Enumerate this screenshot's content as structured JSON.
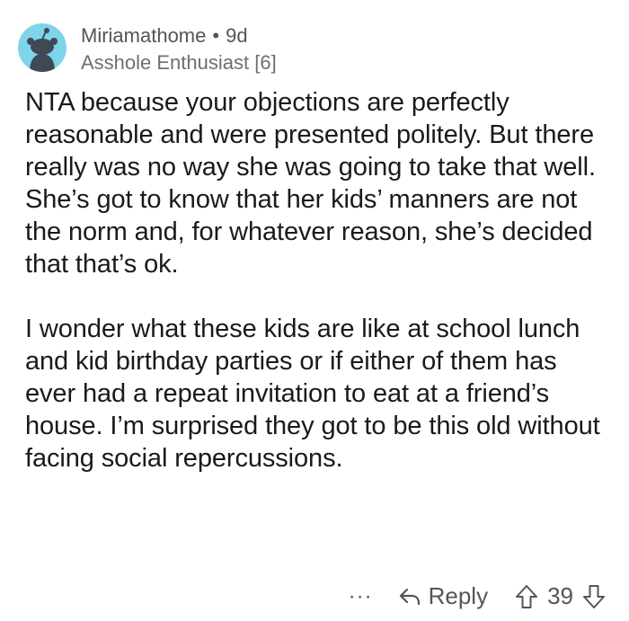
{
  "comment": {
    "username": "Miriamathome",
    "separator": "•",
    "age": "9d",
    "flair": "Asshole Enthusiast [6]",
    "paragraphs": [
      "NTA because your objections are perfectly reasonable and were presented politely. But there really was no way she was going to take that well. She’s got to know that her kids’ manners are not the norm and, for whatever reason, she’s decided that that’s ok.",
      "I wonder what these kids are like at school lunch and kid birthday parties or if either of them has ever had a repeat invitation to eat at a friend’s house. I’m surprised they got to be this old without facing social repercussions."
    ],
    "actions": {
      "more_label": "···",
      "reply_label": "Reply",
      "score": "39"
    }
  },
  "icons": {
    "avatar": "snoo-avatar-icon",
    "reply": "reply-arrow-icon",
    "upvote": "upvote-arrow-icon",
    "downvote": "downvote-arrow-icon"
  },
  "colors": {
    "avatar_bg": "#7fd4ea",
    "meta_text": "#555558",
    "body_text": "#1a1a1b"
  }
}
